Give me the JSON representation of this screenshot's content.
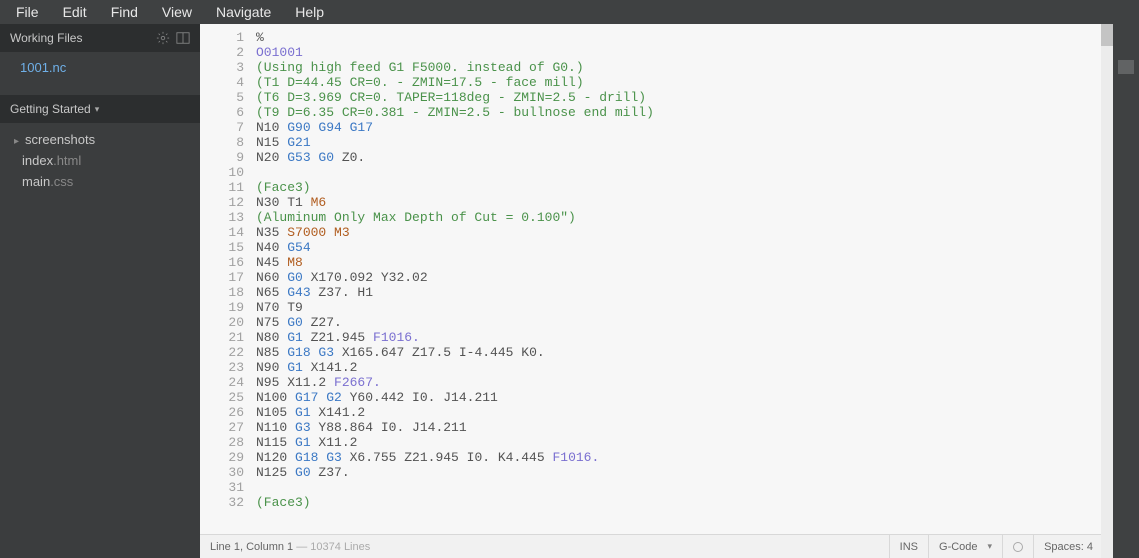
{
  "menubar": [
    "File",
    "Edit",
    "Find",
    "View",
    "Navigate",
    "Help"
  ],
  "sidebar": {
    "workingFilesLabel": "Working Files",
    "workingFiles": [
      "1001.nc"
    ],
    "gettingStartedLabel": "Getting Started",
    "tree": [
      {
        "type": "folder",
        "name": "screenshots"
      },
      {
        "type": "file",
        "base": "index",
        "ext": ".html"
      },
      {
        "type": "file",
        "base": "main",
        "ext": ".css"
      }
    ]
  },
  "code": [
    [
      {
        "t": "",
        "v": "%"
      }
    ],
    [
      {
        "t": "o",
        "v": "O01001"
      }
    ],
    [
      {
        "t": "c",
        "v": "(Using high feed G1 F5000. instead of G0.)"
      }
    ],
    [
      {
        "t": "c",
        "v": "(T1 D=44.45 CR=0. - ZMIN=17.5 - face mill)"
      }
    ],
    [
      {
        "t": "c",
        "v": "(T6 D=3.969 CR=0. TAPER=118deg - ZMIN=2.5 - drill)"
      }
    ],
    [
      {
        "t": "c",
        "v": "(T9 D=6.35 CR=0.381 - ZMIN=2.5 - bullnose end mill)"
      }
    ],
    [
      {
        "t": "",
        "v": "N10 "
      },
      {
        "t": "g",
        "v": "G90 G94 G17"
      }
    ],
    [
      {
        "t": "",
        "v": "N15 "
      },
      {
        "t": "g",
        "v": "G21"
      }
    ],
    [
      {
        "t": "",
        "v": "N20 "
      },
      {
        "t": "g",
        "v": "G53 G0"
      },
      {
        "t": "",
        "v": " Z0."
      }
    ],
    [],
    [
      {
        "t": "c",
        "v": "(Face3)"
      }
    ],
    [
      {
        "t": "",
        "v": "N30 T1 "
      },
      {
        "t": "m",
        "v": "M6"
      }
    ],
    [
      {
        "t": "c",
        "v": "(Aluminum Only Max Depth of Cut = 0.100\")"
      }
    ],
    [
      {
        "t": "",
        "v": "N35 "
      },
      {
        "t": "s",
        "v": "S7000"
      },
      {
        "t": "",
        "v": " "
      },
      {
        "t": "m",
        "v": "M3"
      }
    ],
    [
      {
        "t": "",
        "v": "N40 "
      },
      {
        "t": "g",
        "v": "G54"
      }
    ],
    [
      {
        "t": "",
        "v": "N45 "
      },
      {
        "t": "m",
        "v": "M8"
      }
    ],
    [
      {
        "t": "",
        "v": "N60 "
      },
      {
        "t": "g",
        "v": "G0"
      },
      {
        "t": "",
        "v": " X170.092 Y32.02"
      }
    ],
    [
      {
        "t": "",
        "v": "N65 "
      },
      {
        "t": "g",
        "v": "G43"
      },
      {
        "t": "",
        "v": " Z37. H1"
      }
    ],
    [
      {
        "t": "",
        "v": "N70 T9"
      }
    ],
    [
      {
        "t": "",
        "v": "N75 "
      },
      {
        "t": "g",
        "v": "G0"
      },
      {
        "t": "",
        "v": " Z27."
      }
    ],
    [
      {
        "t": "",
        "v": "N80 "
      },
      {
        "t": "g",
        "v": "G1"
      },
      {
        "t": "",
        "v": " Z21.945 "
      },
      {
        "t": "f",
        "v": "F1016."
      }
    ],
    [
      {
        "t": "",
        "v": "N85 "
      },
      {
        "t": "g",
        "v": "G18 G3"
      },
      {
        "t": "",
        "v": " X165.647 Z17.5 I-4.445 K0."
      }
    ],
    [
      {
        "t": "",
        "v": "N90 "
      },
      {
        "t": "g",
        "v": "G1"
      },
      {
        "t": "",
        "v": " X141.2"
      }
    ],
    [
      {
        "t": "",
        "v": "N95 X11.2 "
      },
      {
        "t": "f",
        "v": "F2667."
      }
    ],
    [
      {
        "t": "",
        "v": "N100 "
      },
      {
        "t": "g",
        "v": "G17 G2"
      },
      {
        "t": "",
        "v": " Y60.442 I0. J14.211"
      }
    ],
    [
      {
        "t": "",
        "v": "N105 "
      },
      {
        "t": "g",
        "v": "G1"
      },
      {
        "t": "",
        "v": " X141.2"
      }
    ],
    [
      {
        "t": "",
        "v": "N110 "
      },
      {
        "t": "g",
        "v": "G3"
      },
      {
        "t": "",
        "v": " Y88.864 I0. J14.211"
      }
    ],
    [
      {
        "t": "",
        "v": "N115 "
      },
      {
        "t": "g",
        "v": "G1"
      },
      {
        "t": "",
        "v": " X11.2"
      }
    ],
    [
      {
        "t": "",
        "v": "N120 "
      },
      {
        "t": "g",
        "v": "G18 G3"
      },
      {
        "t": "",
        "v": " X6.755 Z21.945 I0. K4.445 "
      },
      {
        "t": "f",
        "v": "F1016."
      }
    ],
    [
      {
        "t": "",
        "v": "N125 "
      },
      {
        "t": "g",
        "v": "G0"
      },
      {
        "t": "",
        "v": " Z37."
      }
    ],
    [],
    [
      {
        "t": "c",
        "v": "(Face3)"
      }
    ]
  ],
  "statusbar": {
    "cursor": "Line 1, Column 1",
    "totalLines": "10374 Lines",
    "insertMode": "INS",
    "language": "G-Code",
    "spaces": "Spaces: 4"
  }
}
